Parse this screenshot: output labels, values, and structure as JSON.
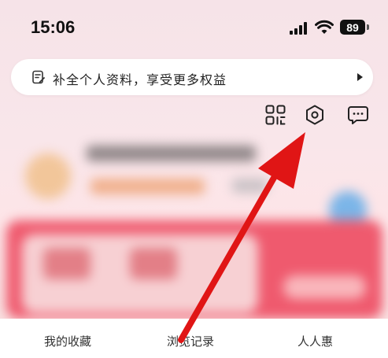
{
  "status_bar": {
    "time": "15:06",
    "battery": "89"
  },
  "banner": {
    "text": "补全个人资料，享受更多权益",
    "icon": "profile-doc-icon"
  },
  "toolbar": {
    "icons": [
      "scan-icon",
      "settings-icon",
      "message-icon"
    ]
  },
  "tabs": [
    {
      "label": "我的收藏"
    },
    {
      "label": "浏览记录"
    },
    {
      "label": "人人惠"
    }
  ],
  "colors": {
    "annotation_arrow": "#e01515",
    "background_top": "#f6e3e8",
    "promo_card": "#ef5a6e"
  }
}
